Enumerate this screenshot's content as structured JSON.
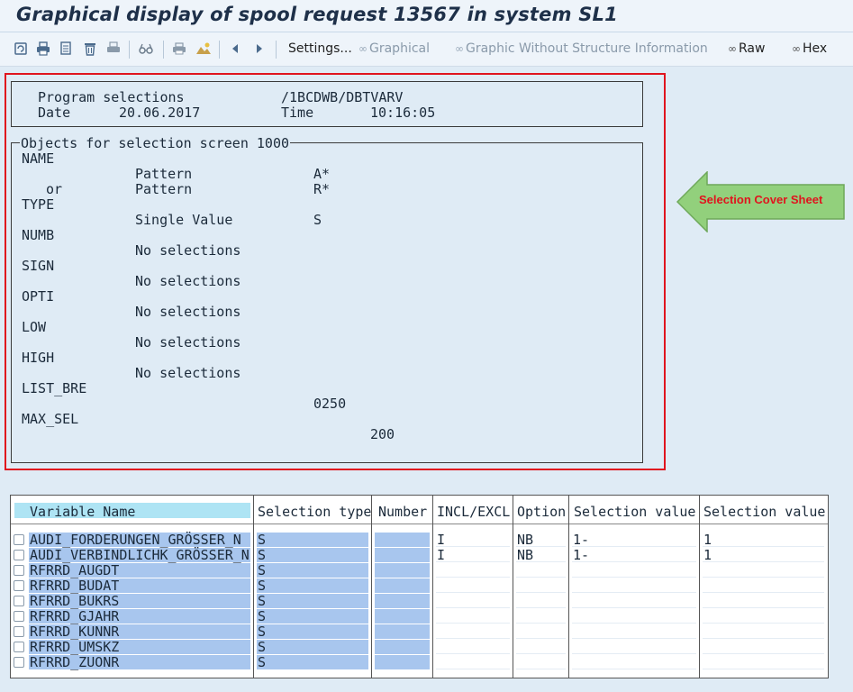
{
  "window": {
    "title": "Graphical display of spool request 13567 in system SL1"
  },
  "toolbar": {
    "icons": [
      "refresh-icon",
      "print-icon",
      "print-preview-icon",
      "delete-icon",
      "print-settings-icon",
      "glasses-icon",
      "printer-icon",
      "image-icon",
      "previous-icon",
      "next-icon"
    ],
    "settings_label": "Settings...",
    "graphical_label": "Graphical",
    "graphic_no_structure_label": "Graphic Without Structure Information",
    "raw_label": "Raw",
    "hex_label": "Hex"
  },
  "header": {
    "program_label": "Program selections",
    "program_value": "/1BCDWB/DBTVARV",
    "date_label": "Date",
    "date_value": "20.06.2017",
    "time_label": "Time",
    "time_value": "10:16:05"
  },
  "objects": {
    "legend": "Objects for selection screen 1000",
    "lines": [
      {
        "field": "NAME"
      },
      {
        "kind": "Pattern",
        "value": "A*"
      },
      {
        "connector": "or",
        "kind": "Pattern",
        "value": "R*"
      },
      {
        "field": "TYPE"
      },
      {
        "kind": "Single Value",
        "value": "S"
      },
      {
        "field": "NUMB"
      },
      {
        "kind": "No selections"
      },
      {
        "field": "SIGN"
      },
      {
        "kind": "No selections"
      },
      {
        "field": "OPTI"
      },
      {
        "kind": "No selections"
      },
      {
        "field": "LOW"
      },
      {
        "kind": "No selections"
      },
      {
        "field": "HIGH"
      },
      {
        "kind": "No selections"
      },
      {
        "field": "LIST_BRE"
      },
      {
        "value": "0250"
      },
      {
        "field": "MAX_SEL"
      },
      {
        "value": "200"
      }
    ]
  },
  "callout": {
    "label": "Selection Cover Sheet",
    "fill": "#92d07c",
    "stroke": "#6ea85a",
    "text_color": "#e0141e"
  },
  "frame_color": "#e0141e",
  "table": {
    "columns": [
      "Variable Name",
      "Selection type",
      "Number",
      "INCL/EXCL",
      "Option",
      "Selection value",
      "Selection value"
    ],
    "rows": [
      [
        "AUDI_FORDERUNGEN_GRÖSSER_N",
        "S",
        "",
        "I",
        "NB",
        "1-",
        "1"
      ],
      [
        "AUDI_VERBINDLICHK_GRÖSSER_N",
        "S",
        "",
        "I",
        "NB",
        "1-",
        "1"
      ],
      [
        "RFRRD_AUGDT",
        "S",
        "",
        "",
        "",
        "",
        ""
      ],
      [
        "RFRRD_BUDAT",
        "S",
        "",
        "",
        "",
        "",
        ""
      ],
      [
        "RFRRD_BUKRS",
        "S",
        "",
        "",
        "",
        "",
        ""
      ],
      [
        "RFRRD_GJAHR",
        "S",
        "",
        "",
        "",
        "",
        ""
      ],
      [
        "RFRRD_KUNNR",
        "S",
        "",
        "",
        "",
        "",
        ""
      ],
      [
        "RFRRD_UMSKZ",
        "S",
        "",
        "",
        "",
        "",
        ""
      ],
      [
        "RFRRD_ZUONR",
        "S",
        "",
        "",
        "",
        "",
        ""
      ]
    ]
  }
}
